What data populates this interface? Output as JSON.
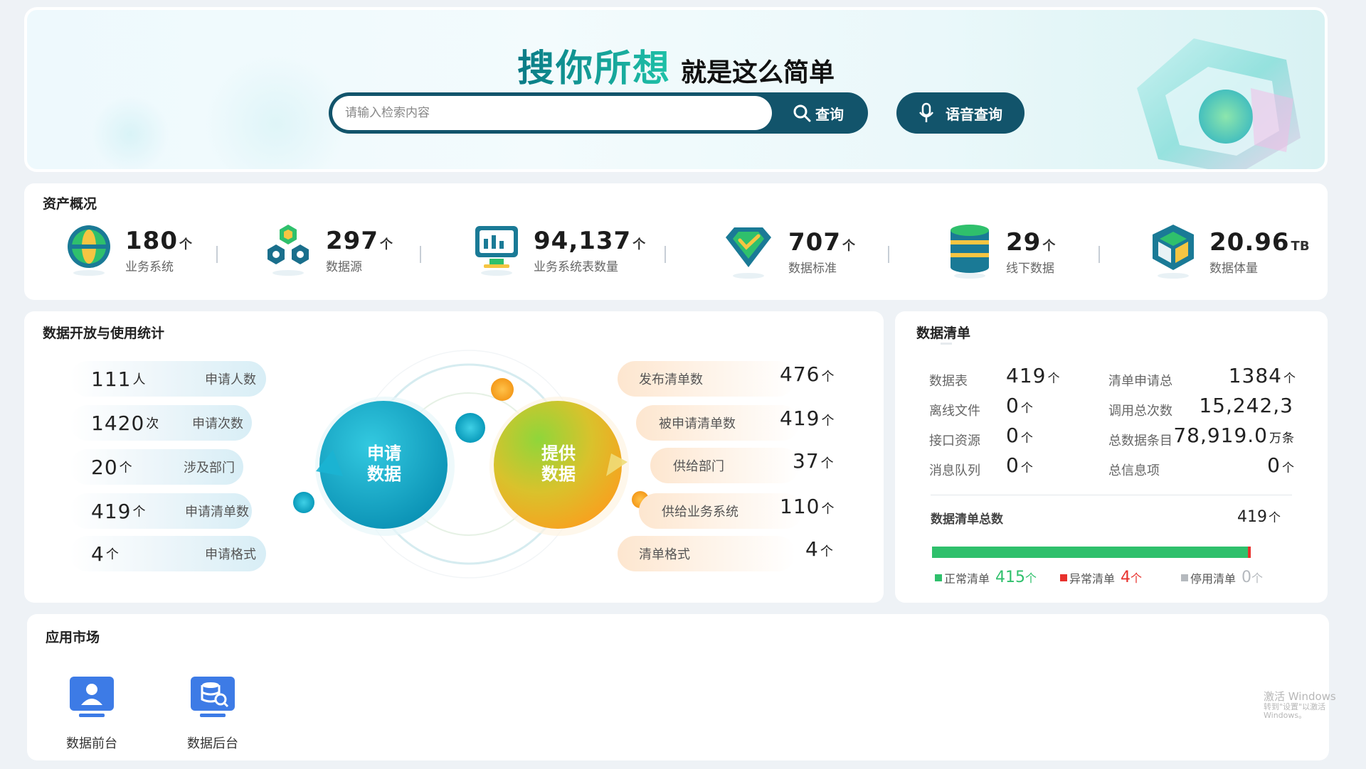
{
  "hero": {
    "slogan_main": "搜你所想",
    "slogan_sub": "就是这么简单",
    "search_placeholder": "请输入检索内容",
    "search_button": "查询",
    "voice_button": "语音查询"
  },
  "assets": {
    "title": "资产概况",
    "items": [
      {
        "value": "180",
        "unit": "个",
        "label": "业务系统",
        "icon": "globe-icon"
      },
      {
        "value": "297",
        "unit": "个",
        "label": "数据源",
        "icon": "hexagons-icon"
      },
      {
        "value": "94,137",
        "unit": "个",
        "label": "业务系统表数量",
        "icon": "monitor-chart-icon"
      },
      {
        "value": "707",
        "unit": "个",
        "label": "数据标准",
        "icon": "diamond-check-icon"
      },
      {
        "value": "29",
        "unit": "个",
        "label": "线下数据",
        "icon": "database-icon"
      },
      {
        "value": "20.96",
        "unit": "TB",
        "label": "数据体量",
        "icon": "cube-icon"
      }
    ]
  },
  "stats": {
    "title": "数据开放与使用统计",
    "left": [
      {
        "value": "111",
        "unit": "人",
        "label": "申请人数"
      },
      {
        "value": "1420",
        "unit": "次",
        "label": "申请次数"
      },
      {
        "value": "20",
        "unit": "个",
        "label": "涉及部门"
      },
      {
        "value": "419",
        "unit": "个",
        "label": "申请清单数"
      },
      {
        "value": "4",
        "unit": "个",
        "label": "申请格式"
      }
    ],
    "right": [
      {
        "value": "476",
        "unit": "个",
        "label": "发布清单数"
      },
      {
        "value": "419",
        "unit": "个",
        "label": "被申请清单数"
      },
      {
        "value": "37",
        "unit": "个",
        "label": "供给部门"
      },
      {
        "value": "110",
        "unit": "个",
        "label": "供给业务系统"
      },
      {
        "value": "4",
        "unit": "个",
        "label": "清单格式"
      }
    ],
    "circle_apply": "申请\n数据",
    "circle_supply": "提供\n数据",
    "circle_apply_l1": "申请",
    "circle_apply_l2": "数据",
    "circle_supply_l1": "提供",
    "circle_supply_l2": "数据"
  },
  "datalist": {
    "title": "数据清单",
    "rows": [
      {
        "l_label": "数据表",
        "l_value": "419",
        "l_unit": "个",
        "r_label": "清单申请总",
        "r_value": "1384",
        "r_unit": "个"
      },
      {
        "l_label": "离线文件",
        "l_value": "0",
        "l_unit": "个",
        "r_label": "调用总次数",
        "r_value": "15,242,3",
        "r_unit": ""
      },
      {
        "l_label": "接口资源",
        "l_value": "0",
        "l_unit": "个",
        "r_label": "总数据条目",
        "r_value": "78,919.0",
        "r_unit": "万条"
      },
      {
        "l_label": "消息队列",
        "l_value": "0",
        "l_unit": "个",
        "r_label": "总信息项",
        "r_value": "0",
        "r_unit": "个"
      }
    ],
    "total_label": "数据清单总数",
    "total_value": "419",
    "total_unit": "个",
    "legend": [
      {
        "label": "正常清单",
        "value": "415",
        "unit": "个",
        "color": "#2fc06c"
      },
      {
        "label": "异常清单",
        "value": "4",
        "unit": "个",
        "color": "#e8312d"
      },
      {
        "label": "停用清单",
        "value": "0",
        "unit": "个",
        "color": "#b5b9be"
      }
    ],
    "normal_fraction": 0.9905,
    "abnormal_fraction": 0.0095
  },
  "apps": {
    "title": "应用市场",
    "items": [
      {
        "label": "数据前台",
        "icon": "user-screen-icon"
      },
      {
        "label": "数据后台",
        "icon": "database-search-icon"
      }
    ]
  },
  "watermark": {
    "line1": "激活 Windows",
    "line2": "转到\"设置\"以激活 Windows。"
  },
  "colors": {
    "primary_dark": "#12546b",
    "teal": "#13a8c6",
    "orange": "#f6a321",
    "green": "#2fc06c",
    "red": "#e8312d"
  }
}
